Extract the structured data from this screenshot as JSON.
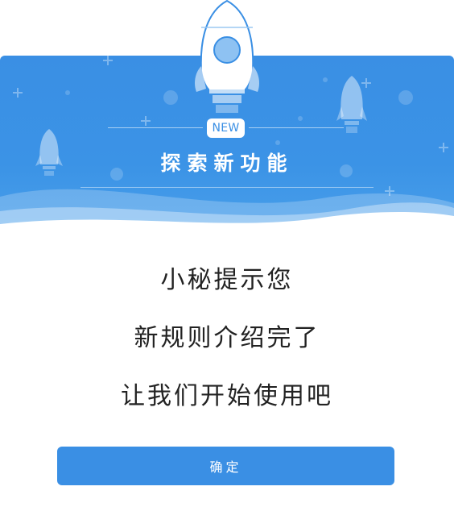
{
  "dialog": {
    "badge": "NEW",
    "title": "探索新功能",
    "messages": [
      "小秘提示您",
      "新规则介绍完了",
      "让我们开始使用吧"
    ],
    "confirm_label": "确定"
  },
  "colors": {
    "accent": "#3a8fe4",
    "banner": "#3b93e6",
    "text": "#222222"
  }
}
